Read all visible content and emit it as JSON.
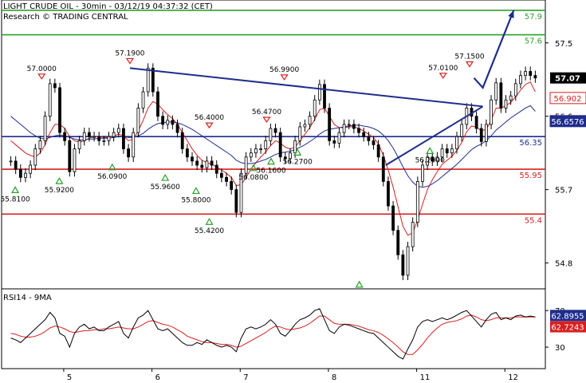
{
  "header": {
    "title": "LIGHT CRUDE OIL - 30min - 03/12/19 04:37:32 (CET)",
    "subtitle": "Research © TRADING CENTRAL"
  },
  "chart_data": {
    "type": "line",
    "instrument": "LIGHT CRUDE OIL",
    "timeframe": "30min",
    "price_axis": {
      "min": 54.6,
      "max": 57.85,
      "ticks": [
        57.5,
        56.6,
        55.7,
        54.8
      ]
    },
    "x_axis": {
      "ticks": [
        {
          "label": "5",
          "bar": 13
        },
        {
          "label": "6",
          "bar": 33
        },
        {
          "label": "7",
          "bar": 53
        },
        {
          "label": "8",
          "bar": 73
        },
        {
          "label": "11",
          "bar": 93
        },
        {
          "label": "12",
          "bar": 113
        }
      ],
      "bars": 120
    },
    "levels": [
      {
        "value": 57.9,
        "label": "57.9",
        "color": "#2ca02c"
      },
      {
        "value": 57.6,
        "label": "57.6",
        "color": "#2ca02c"
      },
      {
        "value": 56.35,
        "label": "56.35",
        "color": "#1f2d8c"
      },
      {
        "value": 55.95,
        "label": "55.95",
        "color": "#d62020"
      },
      {
        "value": 55.4,
        "label": "55.4",
        "color": "#d62020"
      }
    ],
    "last_price": {
      "value": 57.07,
      "label": "57.07"
    },
    "ma_tags": [
      {
        "value": 56.902,
        "label": "56.902",
        "color": "#d62020"
      },
      {
        "value": 56.6576,
        "label": "56.6576",
        "color": "#1f2d8c"
      }
    ],
    "series": [
      {
        "name": "price",
        "color": "#000000",
        "values": [
          56.05,
          55.95,
          55.85,
          55.9,
          56.0,
          56.2,
          56.3,
          56.6,
          57.0,
          56.95,
          56.4,
          56.3,
          55.92,
          56.2,
          56.3,
          56.4,
          56.35,
          56.35,
          56.3,
          56.3,
          56.35,
          56.4,
          56.45,
          56.2,
          56.1,
          56.4,
          56.7,
          56.9,
          57.19,
          56.9,
          56.6,
          56.5,
          56.55,
          56.5,
          56.4,
          56.2,
          56.1,
          56.05,
          56.0,
          55.97,
          56.05,
          56.0,
          55.9,
          55.85,
          55.8,
          55.7,
          55.42,
          55.9,
          56.1,
          56.15,
          56.2,
          56.2,
          56.3,
          56.45,
          56.4,
          56.1,
          56.08,
          56.15,
          56.3,
          56.47,
          56.5,
          56.6,
          56.8,
          56.99,
          56.7,
          56.3,
          56.27,
          56.4,
          56.5,
          56.5,
          56.45,
          56.4,
          56.35,
          56.3,
          56.25,
          56.1,
          55.8,
          55.5,
          55.2,
          54.9,
          54.65,
          55.0,
          55.3,
          55.8,
          56.0,
          56.1,
          56.05,
          56.1,
          56.2,
          56.15,
          56.2,
          56.35,
          56.5,
          56.7,
          56.6,
          56.45,
          56.29,
          56.5,
          56.8,
          57.01,
          56.7,
          56.8,
          56.85,
          57.0,
          57.1,
          57.15,
          57.1,
          57.07
        ]
      },
      {
        "name": "ma-fast",
        "color": "#d62020",
        "values": [
          56.3,
          56.25,
          56.2,
          56.15,
          56.12,
          56.1,
          56.15,
          56.25,
          56.4,
          56.5,
          56.5,
          56.45,
          56.35,
          56.3,
          56.28,
          56.3,
          56.33,
          56.35,
          56.35,
          56.34,
          56.34,
          56.36,
          56.38,
          56.36,
          56.3,
          56.32,
          56.42,
          56.55,
          56.7,
          56.78,
          56.75,
          56.68,
          56.62,
          56.57,
          56.5,
          56.4,
          56.3,
          56.2,
          56.12,
          56.06,
          56.03,
          56.01,
          55.98,
          55.94,
          55.9,
          55.85,
          55.75,
          55.76,
          55.85,
          55.95,
          56.03,
          56.1,
          56.16,
          56.24,
          56.3,
          56.27,
          56.22,
          56.2,
          56.22,
          56.3,
          56.38,
          56.46,
          56.56,
          56.68,
          56.7,
          56.6,
          56.5,
          56.46,
          56.46,
          56.47,
          56.47,
          56.45,
          56.42,
          56.38,
          56.34,
          56.26,
          56.12,
          55.94,
          55.73,
          55.49,
          55.25,
          55.14,
          55.17,
          55.33,
          55.52,
          55.7,
          55.82,
          55.92,
          56.01,
          56.06,
          56.11,
          56.18,
          56.28,
          56.41,
          56.48,
          56.47,
          56.42,
          56.44,
          56.55,
          56.7,
          56.7,
          56.73,
          56.77,
          56.84,
          56.92,
          56.99,
          57.02,
          56.9
        ]
      },
      {
        "name": "ma-slow",
        "color": "#1f2d8c",
        "values": [
          56.6,
          56.55,
          56.5,
          56.45,
          56.4,
          56.36,
          56.33,
          56.32,
          56.34,
          56.36,
          56.37,
          56.36,
          56.34,
          56.32,
          56.31,
          56.31,
          56.32,
          56.32,
          56.33,
          56.33,
          56.33,
          56.34,
          56.35,
          56.35,
          56.34,
          56.34,
          56.36,
          56.39,
          56.44,
          56.48,
          56.51,
          56.52,
          56.53,
          56.53,
          56.52,
          56.5,
          56.47,
          56.44,
          56.4,
          56.36,
          56.32,
          56.28,
          56.24,
          56.2,
          56.16,
          56.12,
          56.06,
          56.03,
          56.02,
          56.02,
          56.03,
          56.05,
          56.07,
          56.1,
          56.13,
          56.15,
          56.16,
          56.17,
          56.19,
          56.22,
          56.25,
          56.29,
          56.33,
          56.38,
          56.42,
          56.44,
          56.45,
          56.46,
          56.47,
          56.48,
          56.49,
          56.49,
          56.48,
          56.47,
          56.45,
          56.42,
          56.37,
          56.3,
          56.21,
          56.1,
          55.98,
          55.87,
          55.79,
          55.74,
          55.73,
          55.74,
          55.77,
          55.81,
          55.86,
          55.91,
          55.96,
          56.01,
          56.07,
          56.13,
          56.19,
          56.23,
          56.26,
          56.3,
          56.36,
          56.43,
          56.48,
          56.53,
          56.58,
          56.62,
          56.66,
          56.7,
          56.73,
          56.66
        ]
      }
    ],
    "annotations": [
      {
        "label": "57.0000",
        "bar": 8,
        "price": 57.0,
        "kind": "high"
      },
      {
        "label": "57.1900",
        "bar": 28,
        "price": 57.19,
        "kind": "high"
      },
      {
        "label": "56.4000",
        "bar": 46,
        "price": 56.4,
        "kind": "high"
      },
      {
        "label": "56.4700",
        "bar": 59,
        "price": 56.47,
        "kind": "high"
      },
      {
        "label": "56.9900",
        "bar": 63,
        "price": 56.99,
        "kind": "high"
      },
      {
        "label": "57.0100",
        "bar": 99,
        "price": 57.01,
        "kind": "high"
      },
      {
        "label": "57.1500",
        "bar": 105,
        "price": 57.15,
        "kind": "high"
      },
      {
        "label": "55.8100",
        "bar": 2,
        "price": 55.81,
        "kind": "low"
      },
      {
        "label": "55.9200",
        "bar": 12,
        "price": 55.92,
        "kind": "low"
      },
      {
        "label": "56.0900",
        "bar": 24,
        "price": 56.09,
        "kind": "low"
      },
      {
        "label": "55.9600",
        "bar": 36,
        "price": 55.96,
        "kind": "low"
      },
      {
        "label": "55.8000",
        "bar": 43,
        "price": 55.8,
        "kind": "low"
      },
      {
        "label": "55.4200",
        "bar": 46,
        "price": 55.42,
        "kind": "low"
      },
      {
        "label": "56.0800",
        "bar": 56,
        "price": 56.08,
        "kind": "low"
      },
      {
        "label": "56.1600",
        "bar": 60,
        "price": 56.16,
        "kind": "low"
      },
      {
        "label": "56.2700",
        "bar": 66,
        "price": 56.27,
        "kind": "low"
      },
      {
        "label": "56.2900",
        "bar": 96,
        "price": 56.29,
        "kind": "low"
      },
      {
        "label": "",
        "bar": 80,
        "price": 54.65,
        "kind": "low"
      }
    ],
    "trendlines": [
      {
        "from": {
          "bar": 28,
          "price": 57.19
        },
        "to": {
          "bar": 108,
          "price": 56.72
        },
        "color": "#1f2d8c"
      },
      {
        "from": {
          "bar": 86,
          "price": 56.0
        },
        "to": {
          "bar": 108,
          "price": 56.72
        },
        "color": "#1f2d8c"
      }
    ],
    "arrow": {
      "points": [
        {
          "bar": 106,
          "price": 57.07
        },
        {
          "bar": 108,
          "price": 56.95
        },
        {
          "bar": 115,
          "price": 57.9
        }
      ],
      "color": "#1f2d8c"
    },
    "rsi": {
      "title": "RSI14 - 9MA",
      "ticks": [
        70,
        30
      ],
      "min": 10,
      "max": 85,
      "last_rsi": {
        "value": 62.8955,
        "label": "62.8955",
        "color": "#1f2d8c"
      },
      "last_ma": {
        "value": 62.7243,
        "label": "62.7243",
        "color": "#d62020"
      },
      "rsi_values": [
        40,
        38,
        35,
        40,
        45,
        50,
        55,
        60,
        68,
        62,
        45,
        42,
        30,
        45,
        52,
        55,
        50,
        52,
        48,
        48,
        52,
        55,
        58,
        45,
        40,
        52,
        62,
        65,
        70,
        60,
        50,
        48,
        50,
        45,
        40,
        35,
        32,
        32,
        35,
        33,
        38,
        35,
        32,
        30,
        32,
        30,
        25,
        40,
        50,
        52,
        50,
        52,
        55,
        60,
        55,
        45,
        42,
        48,
        55,
        60,
        62,
        65,
        70,
        72,
        60,
        48,
        45,
        52,
        55,
        54,
        52,
        50,
        48,
        46,
        45,
        40,
        35,
        30,
        25,
        20,
        17,
        28,
        38,
        52,
        58,
        60,
        58,
        60,
        62,
        60,
        62,
        65,
        68,
        70,
        64,
        58,
        52,
        60,
        66,
        68,
        60,
        62,
        60,
        64,
        65,
        63,
        64,
        63
      ],
      "ma_values": [
        45,
        44,
        42,
        41,
        41,
        42,
        44,
        47,
        51,
        53,
        52,
        50,
        47,
        46,
        47,
        48,
        48,
        49,
        49,
        50,
        50,
        51,
        52,
        51,
        50,
        50,
        52,
        55,
        58,
        59,
        57,
        55,
        54,
        52,
        49,
        46,
        42,
        40,
        38,
        36,
        35,
        35,
        34,
        33,
        33,
        32,
        30,
        31,
        34,
        37,
        40,
        43,
        46,
        50,
        53,
        52,
        50,
        49,
        50,
        51,
        53,
        56,
        60,
        64,
        64,
        60,
        56,
        55,
        55,
        55,
        54,
        53,
        51,
        49,
        48,
        46,
        43,
        39,
        35,
        30,
        25,
        22,
        22,
        27,
        33,
        40,
        46,
        51,
        55,
        57,
        58,
        59,
        61,
        64,
        65,
        63,
        60,
        59,
        60,
        62,
        62,
        62,
        62,
        63,
        63,
        63,
        63,
        63
      ]
    }
  }
}
